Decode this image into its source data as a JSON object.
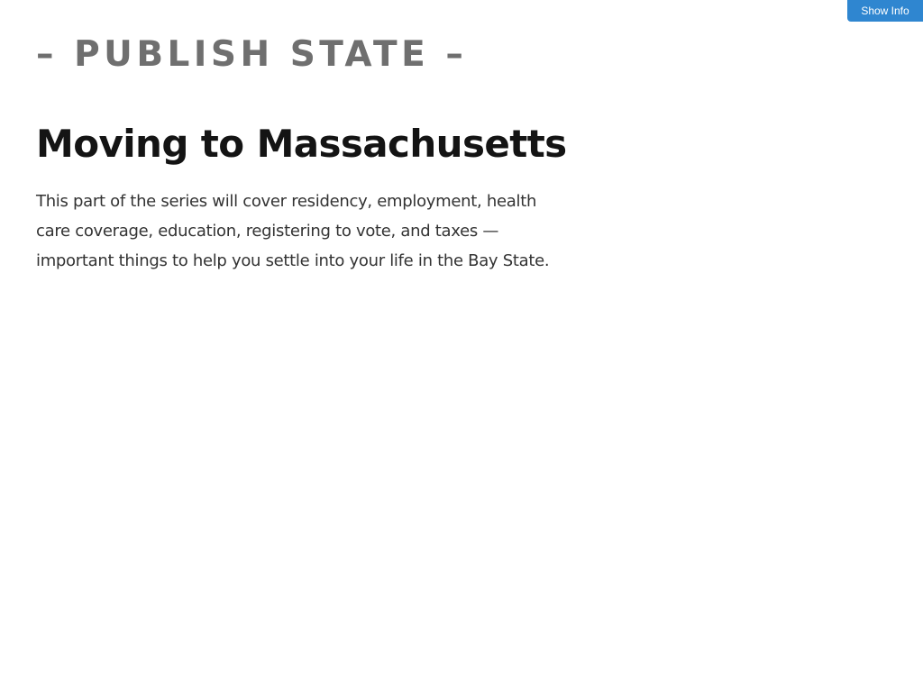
{
  "header": {
    "show_info_label": "Show Info"
  },
  "page": {
    "state_label": "– PUBLISH STATE –",
    "title": "Moving to Massachusetts",
    "intro": "This part of the series will cover residency, employment, health care coverage, education, registering to vote, and taxes — important things to help you settle into your life in the Bay State."
  },
  "colors": {
    "accent": "#2f86d0",
    "state_label": "#6f6f6f",
    "title": "#141414",
    "body_text": "#333333"
  }
}
